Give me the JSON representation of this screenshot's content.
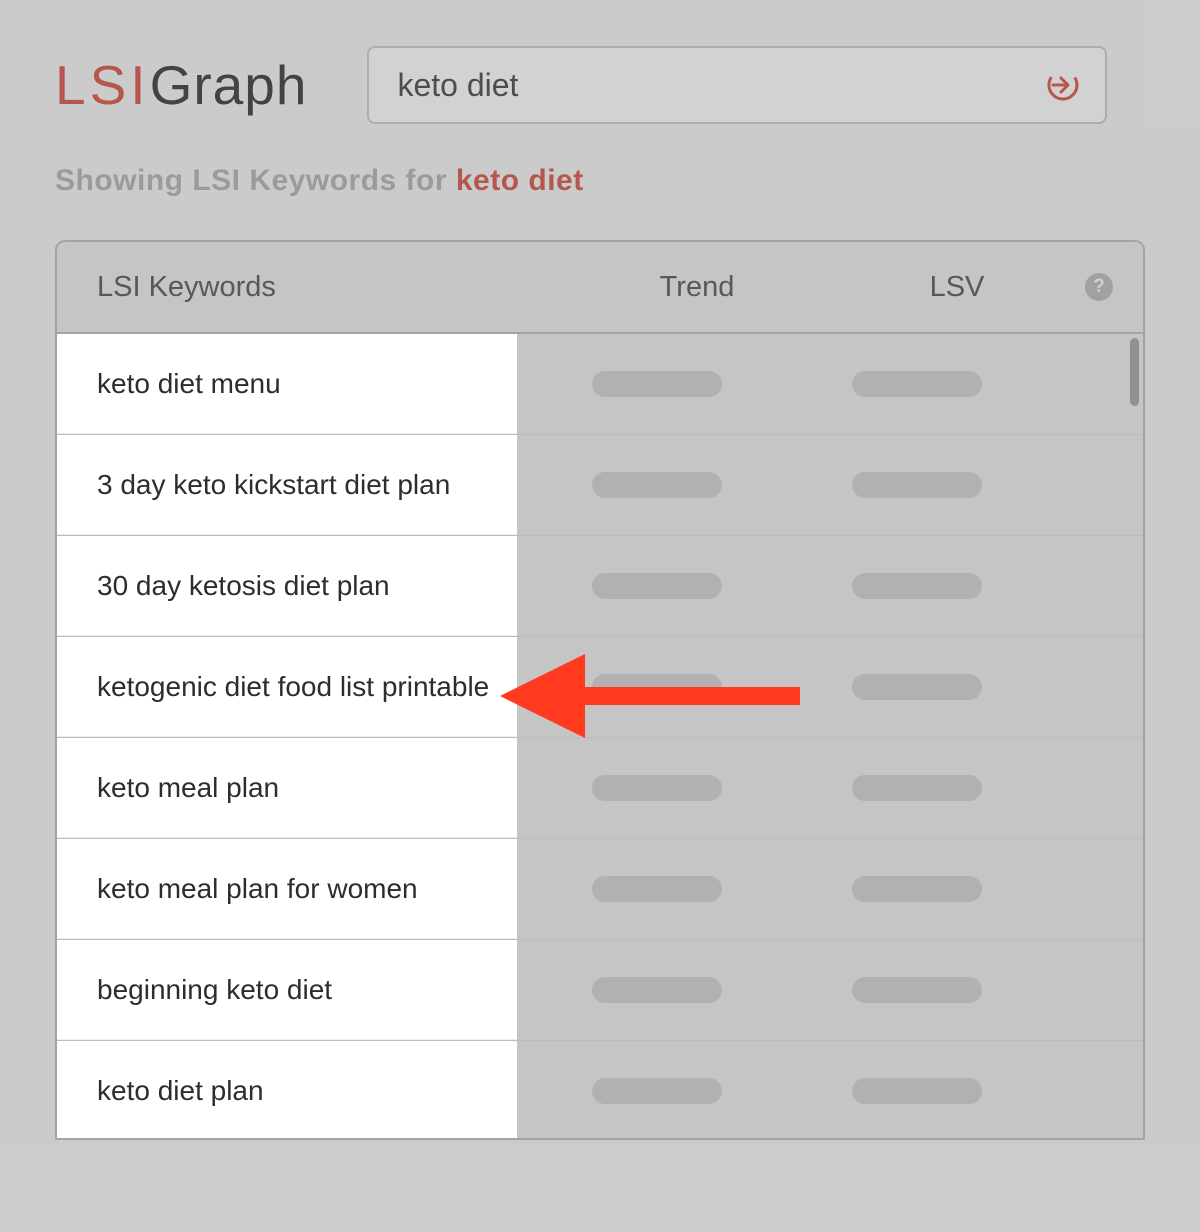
{
  "brand": {
    "part1": "LSI",
    "part2": "Graph"
  },
  "search": {
    "value": "keto diet"
  },
  "subheading": {
    "prefix": "Showing LSI Keywords for ",
    "term": "keto diet"
  },
  "columns": {
    "kw": "LSI Keywords",
    "trend": "Trend",
    "lsv": "LSV",
    "help": "?"
  },
  "rows": [
    {
      "keyword": "keto diet menu"
    },
    {
      "keyword": "3 day keto kickstart diet plan"
    },
    {
      "keyword": "30 day ketosis diet plan"
    },
    {
      "keyword": "ketogenic diet food list printable"
    },
    {
      "keyword": "keto meal plan"
    },
    {
      "keyword": "keto meal plan for women"
    },
    {
      "keyword": "beginning keto diet"
    },
    {
      "keyword": "keto diet plan"
    }
  ]
}
